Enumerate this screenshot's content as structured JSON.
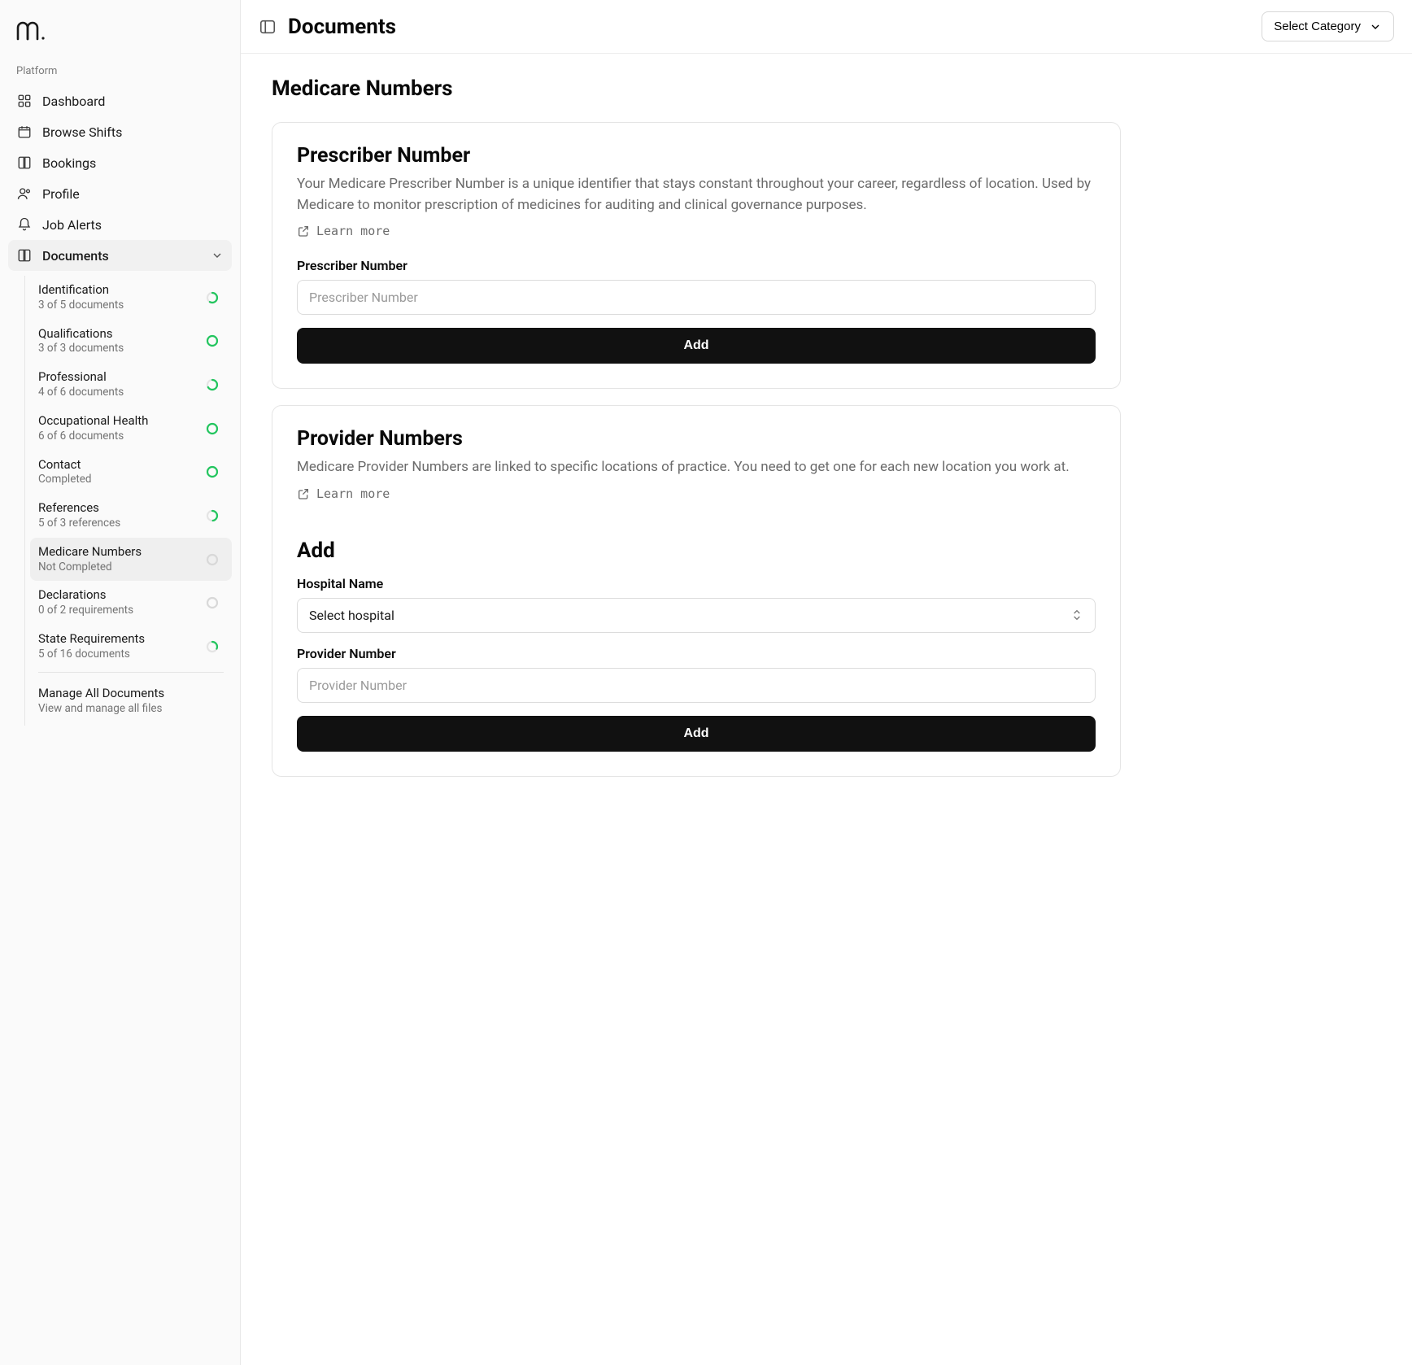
{
  "sidebar": {
    "section_label": "Platform",
    "items": [
      {
        "label": "Dashboard"
      },
      {
        "label": "Browse Shifts"
      },
      {
        "label": "Bookings"
      },
      {
        "label": "Profile"
      },
      {
        "label": "Job Alerts"
      }
    ],
    "documents": {
      "label": "Documents",
      "children": [
        {
          "title": "Identification",
          "subtitle": "3 of 5 documents",
          "ring": "partial"
        },
        {
          "title": "Qualifications",
          "subtitle": "3 of 3 documents",
          "ring": "full"
        },
        {
          "title": "Professional",
          "subtitle": "4 of 6 documents",
          "ring": "partial"
        },
        {
          "title": "Occupational Health",
          "subtitle": "6 of 6 documents",
          "ring": "full"
        },
        {
          "title": "Contact",
          "subtitle": "Completed",
          "ring": "full"
        },
        {
          "title": "References",
          "subtitle": "5 of 3 references",
          "ring": "partial"
        },
        {
          "title": "Medicare Numbers",
          "subtitle": "Not Completed",
          "ring": "empty",
          "active": true
        },
        {
          "title": "Declarations",
          "subtitle": "0 of 2 requirements",
          "ring": "empty"
        },
        {
          "title": "State Requirements",
          "subtitle": "5 of 16 documents",
          "ring": "partial"
        }
      ],
      "manage": {
        "title": "Manage All Documents",
        "subtitle": "View and manage all files"
      }
    }
  },
  "header": {
    "title": "Documents",
    "category_label": "Select Category"
  },
  "page": {
    "title": "Medicare Numbers",
    "prescriber": {
      "heading": "Prescriber Number",
      "desc": "Your Medicare Prescriber Number is a unique identifier that stays constant throughout your career, regardless of location. Used by Medicare to monitor prescription of medicines for auditing and clinical governance purposes.",
      "learn_more": "Learn more",
      "field_label": "Prescriber Number",
      "placeholder": "Prescriber Number",
      "button": "Add"
    },
    "provider": {
      "heading": "Provider Numbers",
      "desc": "Medicare Provider Numbers are linked to specific locations of practice. You need to get one for each new location you work at.",
      "learn_more": "Learn more",
      "add_heading": "Add",
      "hospital_label": "Hospital Name",
      "hospital_placeholder": "Select hospital",
      "number_label": "Provider Number",
      "number_placeholder": "Provider Number",
      "button": "Add"
    }
  }
}
